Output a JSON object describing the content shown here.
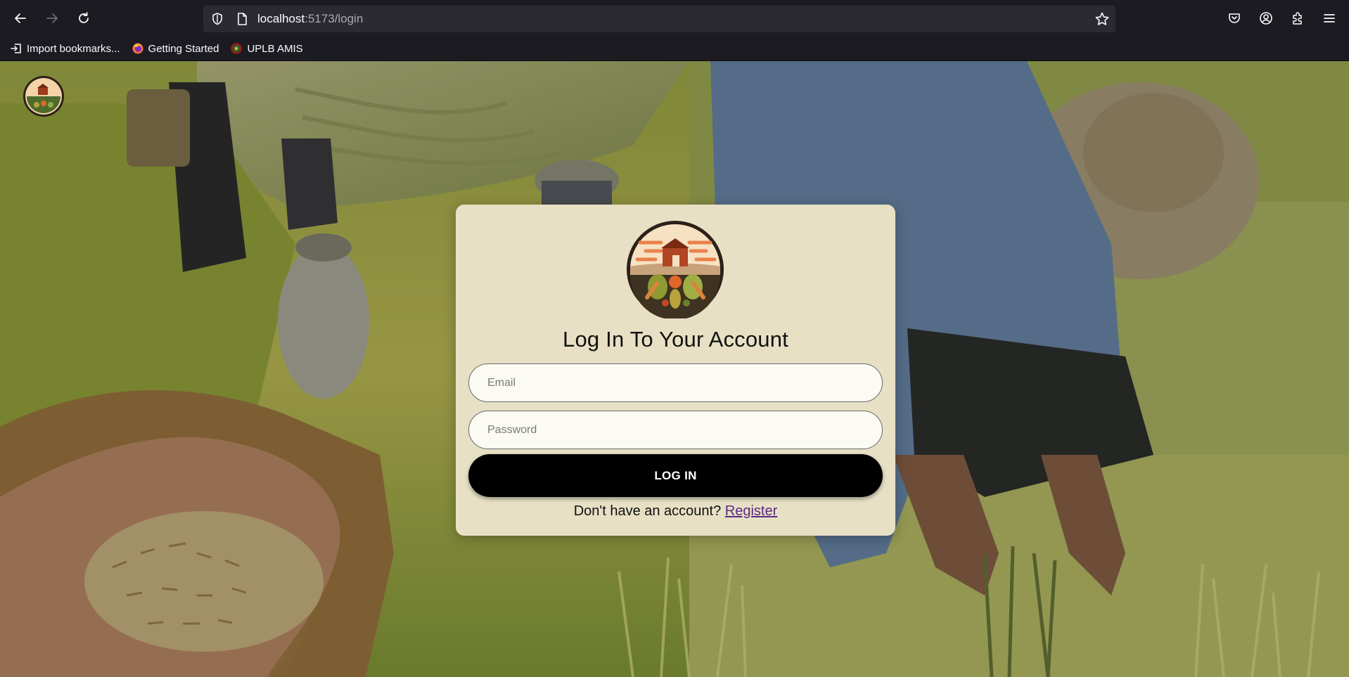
{
  "browser": {
    "url_host": "localhost",
    "url_path": ":5173/login",
    "bookmarks": [
      {
        "label": "Import bookmarks..."
      },
      {
        "label": "Getting Started"
      },
      {
        "label": "UPLB AMIS"
      }
    ]
  },
  "login": {
    "title": "Log In To Your Account",
    "email_placeholder": "Email",
    "password_placeholder": "Password",
    "submit_label": "LOG IN",
    "register_prompt": "Don't have an account?",
    "register_link": "Register"
  },
  "colors": {
    "card_bg": "#e7e0c5",
    "button_bg": "#000000",
    "link": "#5b2a86",
    "chrome_bg": "#1c1b22"
  },
  "icons": [
    "back-arrow-icon",
    "forward-arrow-icon",
    "reload-icon",
    "shield-icon",
    "page-icon",
    "bookmark-star-icon",
    "pocket-icon",
    "account-icon",
    "extensions-icon",
    "menu-icon",
    "import-icon",
    "firefox-icon",
    "uplb-icon",
    "farm-logo-icon"
  ]
}
